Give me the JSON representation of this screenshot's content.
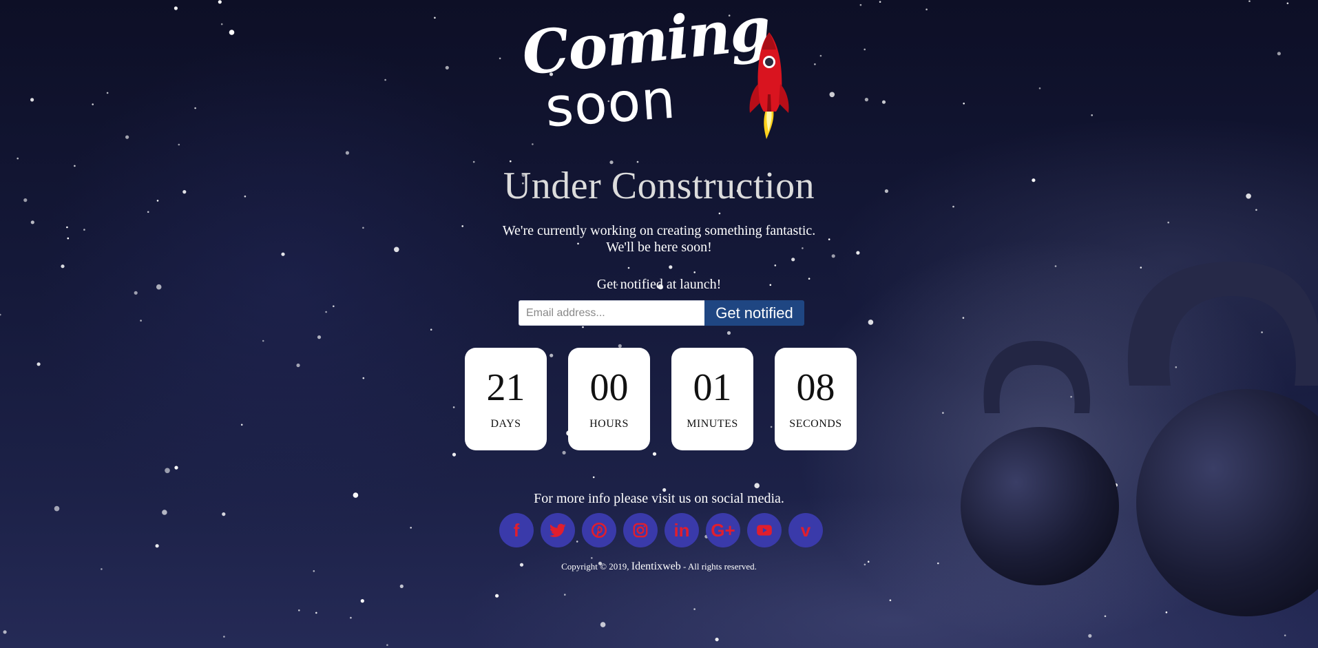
{
  "logo": {
    "line1": "Coming",
    "line2": "soon"
  },
  "heading": "Under Construction",
  "subtitle_line1": "We're currently working on creating something fantastic.",
  "subtitle_line2": "We'll be here soon!",
  "notify": {
    "label": "Get notified at launch!",
    "email_placeholder": "Email address...",
    "button_label": "Get notified",
    "button_color": "#1f4682"
  },
  "countdown": [
    {
      "value": "21",
      "label": "DAYS"
    },
    {
      "value": "00",
      "label": "HOURS"
    },
    {
      "value": "01",
      "label": "MINUTES"
    },
    {
      "value": "08",
      "label": "SECONDS"
    }
  ],
  "social": {
    "text": "For more info please visit us on social media.",
    "icon_bg_color": "#3a3aaa",
    "icon_color": "#e01e2e",
    "icons": [
      {
        "name": "facebook-icon",
        "glyph": "f"
      },
      {
        "name": "twitter-icon",
        "glyph": ""
      },
      {
        "name": "pinterest-icon",
        "glyph": ""
      },
      {
        "name": "instagram-icon",
        "glyph": ""
      },
      {
        "name": "linkedin-icon",
        "glyph": "in"
      },
      {
        "name": "google-plus-icon",
        "glyph": "G+"
      },
      {
        "name": "youtube-icon",
        "glyph": ""
      },
      {
        "name": "vimeo-icon",
        "glyph": "v"
      }
    ]
  },
  "footer": {
    "copyright_prefix": "Copyright © 2019, ",
    "brand": "Identixweb",
    "copyright_suffix": " - All rights reserved."
  }
}
